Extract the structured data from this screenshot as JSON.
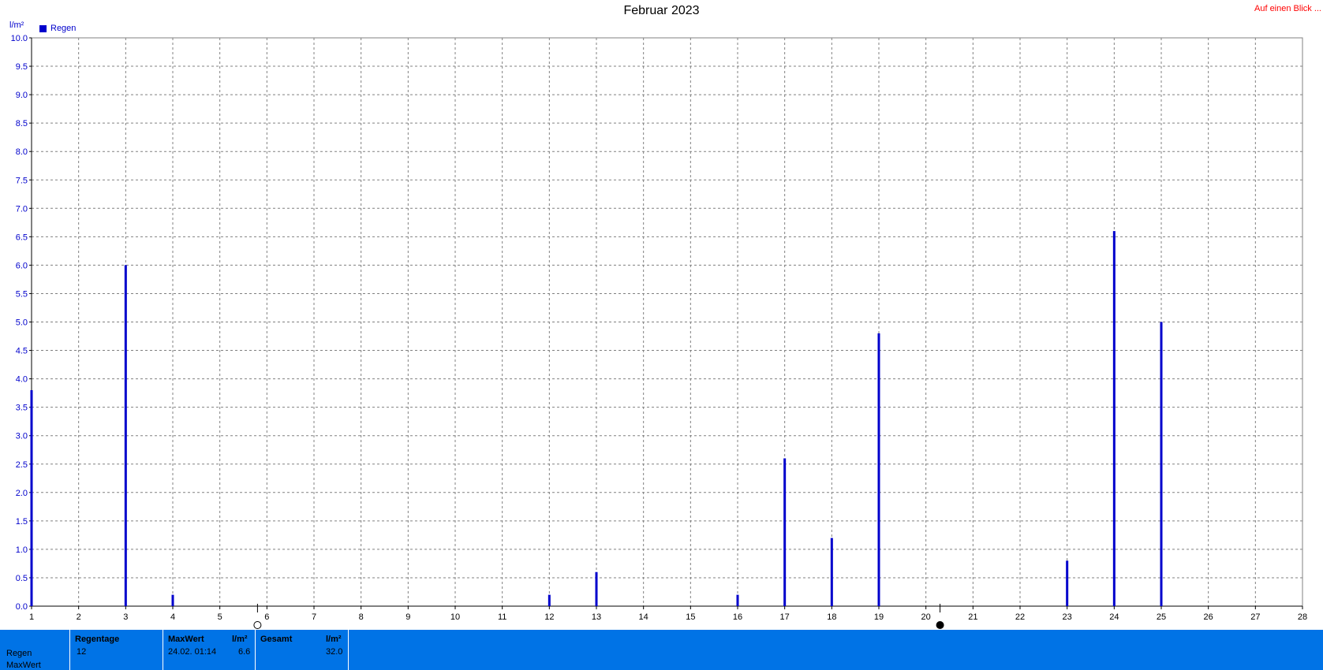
{
  "header": {
    "title": "Februar 2023",
    "at_a_glance": "Auf einen Blick ...",
    "unit": "l/m²",
    "legend": "Regen"
  },
  "chart_data": {
    "type": "bar",
    "title": "Februar 2023",
    "ylabel": "l/m²",
    "xlim": [
      1,
      28
    ],
    "ylim": [
      0,
      10
    ],
    "x_ticks": [
      1,
      2,
      3,
      4,
      5,
      6,
      7,
      8,
      9,
      10,
      11,
      12,
      13,
      14,
      15,
      16,
      17,
      18,
      19,
      20,
      21,
      22,
      23,
      24,
      25,
      26,
      27,
      28
    ],
    "y_ticks": [
      "0.0",
      "0.5",
      "1.0",
      "1.5",
      "2.0",
      "2.5",
      "3.0",
      "3.5",
      "4.0",
      "4.5",
      "5.0",
      "5.5",
      "6.0",
      "6.5",
      "7.0",
      "7.5",
      "8.0",
      "8.5",
      "9.0",
      "9.5",
      "10.0"
    ],
    "grid": true,
    "series": [
      {
        "name": "Regen",
        "color": "#0000cc",
        "points": [
          {
            "x": 1,
            "y": 3.8
          },
          {
            "x": 3,
            "y": 6.0
          },
          {
            "x": 4,
            "y": 0.2
          },
          {
            "x": 12,
            "y": 0.2
          },
          {
            "x": 13,
            "y": 0.6
          },
          {
            "x": 16,
            "y": 0.2
          },
          {
            "x": 17,
            "y": 2.6
          },
          {
            "x": 18,
            "y": 1.2
          },
          {
            "x": 19,
            "y": 4.8
          },
          {
            "x": 23,
            "y": 0.8
          },
          {
            "x": 24,
            "y": 6.6
          },
          {
            "x": 25,
            "y": 5.0
          }
        ]
      }
    ],
    "moon_phases": [
      {
        "x": 5.8,
        "phase": "full-moon"
      },
      {
        "x": 20.3,
        "phase": "new-moon"
      }
    ]
  },
  "summary": {
    "row_labels": [
      "Regen",
      "MaxWert"
    ],
    "regentage": {
      "header": "Regentage",
      "value": "12"
    },
    "maxwert": {
      "header": "MaxWert",
      "unit": "l/m²",
      "date": "24.02.  01:14",
      "value": "6.6"
    },
    "gesamt": {
      "header": "Gesamt",
      "unit": "l/m²",
      "value": "32.0"
    }
  },
  "colors": {
    "series": "#0000cc",
    "axis_text": "#0000cc",
    "panel_bg": "#0073e6",
    "link": "#ff0000"
  }
}
